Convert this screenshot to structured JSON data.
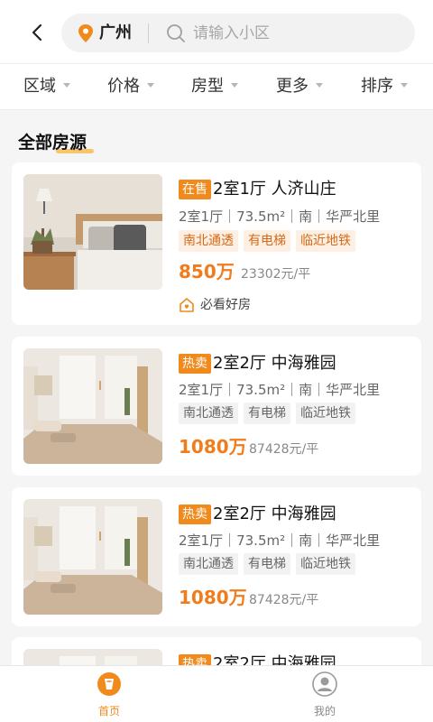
{
  "header": {
    "city": "广州",
    "search_placeholder": "请输入小区"
  },
  "filters": [
    "区域",
    "价格",
    "房型",
    "更多",
    "排序"
  ],
  "section_title": "全部房源",
  "listings": [
    {
      "badge": "在售",
      "badge_color": "#f08a1c",
      "title": "2室1厅  人济山庄",
      "meta": "2室1厅｜73.5m²｜南｜华严北里",
      "tags": [
        "南北通透",
        "有电梯",
        "临近地铁"
      ],
      "tag_style": "hot",
      "price": "850万",
      "unit_price": "23302元/平",
      "extra": "必看好房"
    },
    {
      "badge": "热卖",
      "badge_color": "#f08a1c",
      "title": "2室2厅  中海雅园",
      "meta": "2室1厅｜73.5m²｜南｜华严北里",
      "tags": [
        "南北通透",
        "有电梯",
        "临近地铁"
      ],
      "tag_style": "plain",
      "price": "1080万",
      "unit_price": "87428元/平"
    },
    {
      "badge": "热卖",
      "badge_color": "#f08a1c",
      "title": "2室2厅  中海雅园",
      "meta": "2室1厅｜73.5m²｜南｜华严北里",
      "tags": [
        "南北通透",
        "有电梯",
        "临近地铁"
      ],
      "tag_style": "plain",
      "price": "1080万",
      "unit_price": "87428元/平"
    },
    {
      "badge": "热卖",
      "badge_color": "#f08a1c",
      "title": "2室2厅  中海雅园"
    }
  ],
  "tabbar": {
    "home": "首页",
    "mine": "我的",
    "active_color": "#f08a1c"
  }
}
